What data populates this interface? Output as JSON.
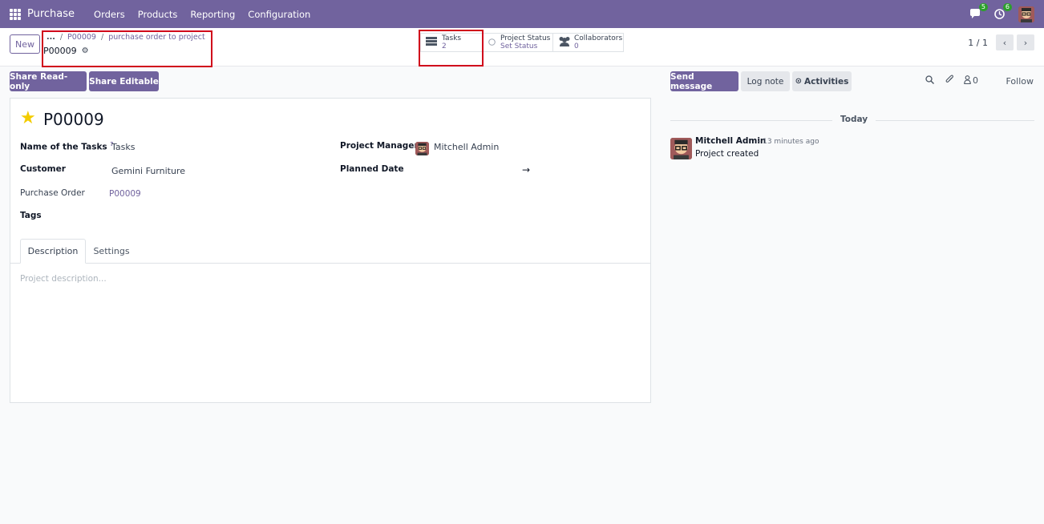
{
  "navbar": {
    "app_name": "Purchase",
    "menu": [
      "Orders",
      "Products",
      "Reporting",
      "Configuration"
    ],
    "messages_badge": "5",
    "activities_badge": "6",
    "accent_color": "#71639e"
  },
  "control_panel": {
    "new_label": "New",
    "breadcrumb": [
      "...",
      "P00009",
      "purchase order to project"
    ],
    "record_name": "P00009",
    "smart_buttons": {
      "tasks_label": "Tasks",
      "tasks_value": "2",
      "status_label": "Project Status",
      "status_value": "Set Status",
      "collaborators_label": "Collaborators",
      "collaborators_value": "0"
    },
    "pager_text": "1 / 1"
  },
  "actions": {
    "share_readonly": "Share Read-only",
    "share_editable": "Share Editable"
  },
  "form": {
    "title": "P00009",
    "fields": {
      "name_of_tasks_label": "Name of the Tasks",
      "name_of_tasks_help": "?",
      "name_of_tasks_value": "Tasks",
      "customer_label": "Customer",
      "customer_value": "Gemini Furniture",
      "purchase_order_label": "Purchase Order",
      "purchase_order_value": "P00009",
      "tags_label": "Tags",
      "project_manager_label": "Project Manager",
      "project_manager_value": "Mitchell Admin",
      "planned_date_label": "Planned Date",
      "planned_date_arrow": "→"
    },
    "tabs": [
      "Description",
      "Settings"
    ],
    "description_placeholder": "Project description..."
  },
  "chatter": {
    "send_message": "Send message",
    "log_note": "Log note",
    "activities": "Activities",
    "followers_count": "0",
    "follow": "Follow",
    "date_separator": "Today",
    "messages": [
      {
        "author": "Mitchell Admin",
        "time": "- 13 minutes ago",
        "body": "Project created"
      }
    ]
  }
}
